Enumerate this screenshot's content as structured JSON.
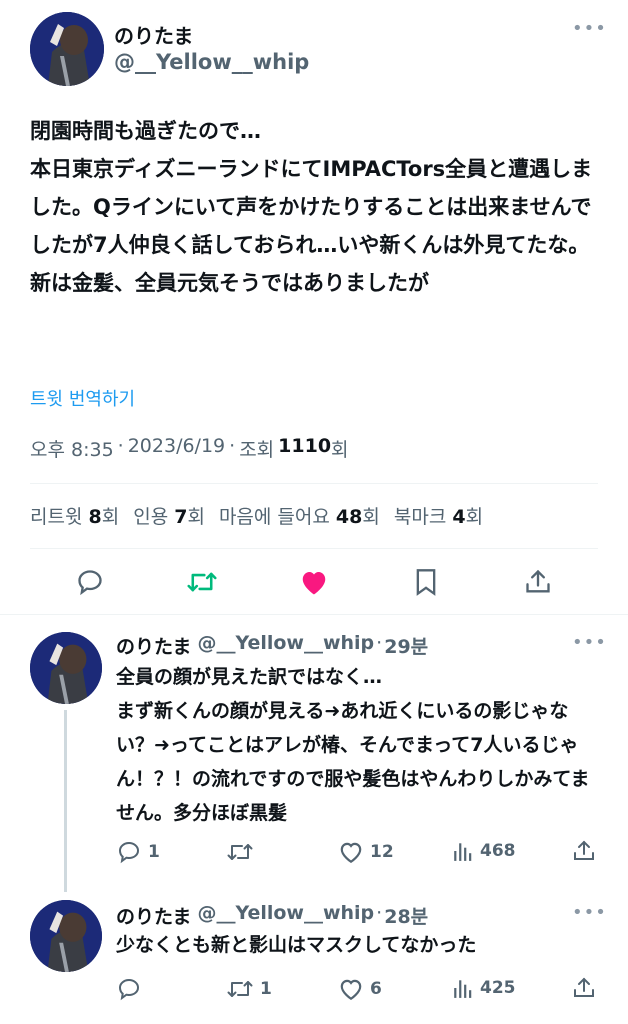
{
  "main_tweet": {
    "display_name": "のりたま",
    "handle": "@__Yellow__whip",
    "text": "閉園時間も過ぎたので…\n本日東京ディズニーランドにてIMPACTors全員と遭遇しました。Qラインにいて声をかけたりすることは出来ませんでしたが7人仲良く話しておられ…いや新くんは外見てたな。\n新は金髪、全員元気そうではありましたが",
    "translate_link": "트윗 번역하기",
    "time": "오후 8:35",
    "date": "2023/6/19",
    "views_label": "조회",
    "views_count": "1110",
    "views_unit": "회",
    "stats": {
      "retweets_label": "리트윗",
      "retweets_count": "8",
      "retweets_unit": "회",
      "quotes_label": "인용",
      "quotes_count": "7",
      "quotes_unit": "회",
      "likes_label": "마음에 들어요",
      "likes_count": "48",
      "likes_unit": "회",
      "bookmarks_label": "북마크",
      "bookmarks_count": "4",
      "bookmarks_unit": "회"
    }
  },
  "replies": [
    {
      "display_name": "のりたま",
      "handle": "@__Yellow__whip",
      "time_ago": "29분",
      "text": "全員の顔が見えた訳ではなく…\nまず新くんの顔が見える➜あれ近くにいるの影じゃない？➜ってことはアレが椿、そんでまって7人いるじゃん！？！の流れですので服や髪色はやんわりしかみてません。多分ほぼ黒髪",
      "reply_count": "1",
      "retweet_count": "",
      "like_count": "12",
      "view_count": "468"
    },
    {
      "display_name": "のりたま",
      "handle": "@__Yellow__whip",
      "time_ago": "28분",
      "text": "少なくとも新と影山はマスクしてなかった",
      "reply_count": "",
      "retweet_count": "1",
      "like_count": "6",
      "view_count": "425"
    }
  ],
  "separator": "·",
  "colors": {
    "link": "#1d9bf0",
    "retweet_active": "#00ba7c",
    "like_active": "#f91880",
    "muted": "#536471"
  }
}
